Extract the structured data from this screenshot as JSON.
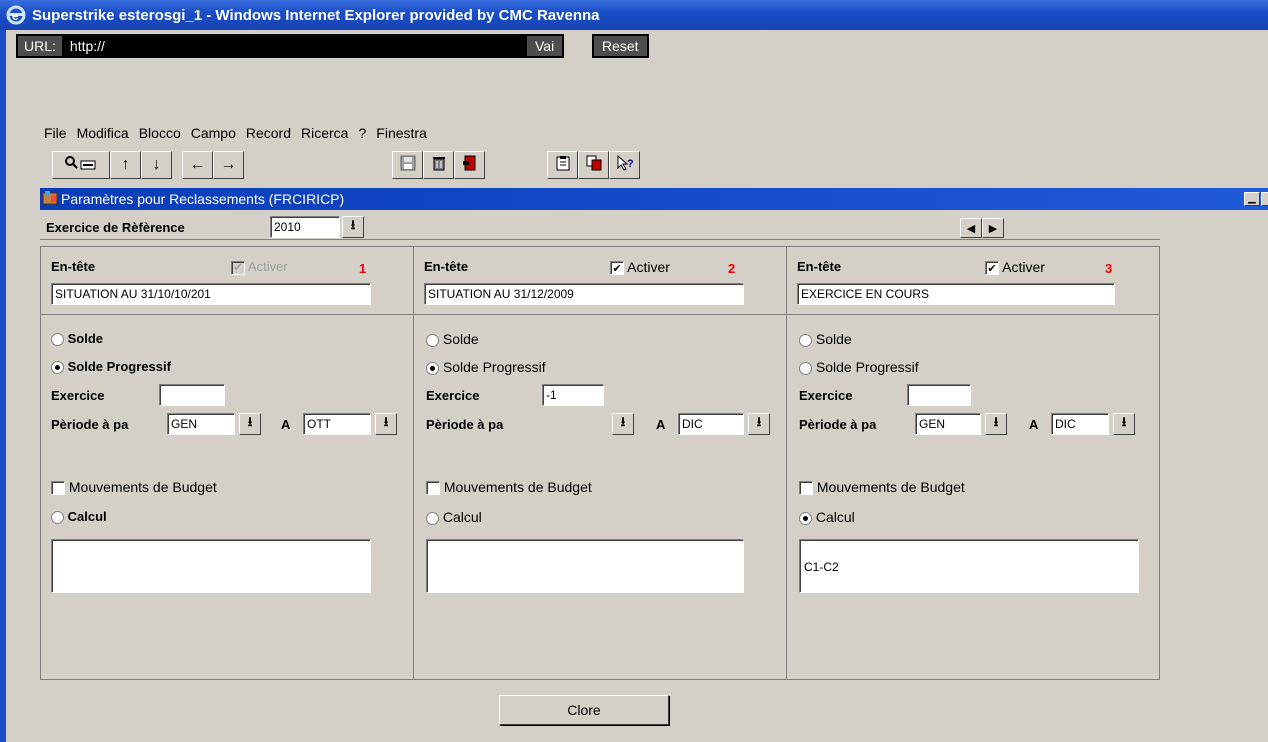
{
  "window": {
    "title": "Superstrike esterosgi_1 - Windows Internet Explorer provided by CMC Ravenna"
  },
  "urlbar": {
    "label": "URL:",
    "value": "http://",
    "go_label": "Vai",
    "reset_label": "Reset"
  },
  "menu": {
    "items": [
      "File",
      "Modifica",
      "Blocco",
      "Campo",
      "Record",
      "Ricerca",
      "?",
      "Finestra"
    ]
  },
  "panel": {
    "title": "Paramètres pour Reclassements (FRCIRICP)"
  },
  "reference": {
    "label": "Exercice de Rèfèrence",
    "value": "2010"
  },
  "columns": [
    {
      "number": "1",
      "header_label": "En-tête",
      "activate_label": "Activer",
      "activate_checked": true,
      "activate_disabled": true,
      "header_value": "SITUATION AU 31/10/10/201",
      "solde_label": "Solde",
      "solde_progressif_label": "Solde Progressif",
      "selected": "solde_progressif",
      "exercice_label": "Exercice",
      "exercice_value": "",
      "periode_label": "Pèriode à pa",
      "periode_from": "GEN",
      "a_label": "A",
      "periode_to": "OTT",
      "budget_label": "Mouvements de Budget",
      "budget_checked": false,
      "calcul_label": "Calcul",
      "calcul_value": "",
      "bold_labels": true
    },
    {
      "number": "2",
      "header_label": "En-tête",
      "activate_label": "Activer",
      "activate_checked": true,
      "activate_disabled": false,
      "header_value": "SITUATION AU 31/12/2009",
      "solde_label": "Solde",
      "solde_progressif_label": "Solde Progressif",
      "selected": "solde_progressif",
      "exercice_label": "Exercice",
      "exercice_value": "-1",
      "periode_label": "Pèriode à pa",
      "periode_from": "",
      "a_label": "A",
      "periode_to": "DIC",
      "budget_label": "Mouvements de Budget",
      "budget_checked": false,
      "calcul_label": "Calcul",
      "calcul_value": "",
      "bold_labels": false
    },
    {
      "number": "3",
      "header_label": "En-tête",
      "activate_label": "Activer",
      "activate_checked": true,
      "activate_disabled": false,
      "header_value": "EXERCICE EN COURS",
      "solde_label": "Solde",
      "solde_progressif_label": "Solde Progressif",
      "selected": "calcul",
      "exercice_label": "Exercice",
      "exercice_value": "",
      "periode_label": "Pèriode à pa",
      "periode_from": "GEN",
      "a_label": "A",
      "periode_to": "DIC",
      "budget_label": "Mouvements de Budget",
      "budget_checked": false,
      "calcul_label": "Calcul",
      "calcul_value": "C1-C2",
      "bold_labels": false
    }
  ],
  "footer": {
    "close_label": "Clore"
  },
  "colors": {
    "title_blue": "#1a4fc8",
    "frame_gray": "#d4d0c8",
    "number_red": "#e00000"
  }
}
